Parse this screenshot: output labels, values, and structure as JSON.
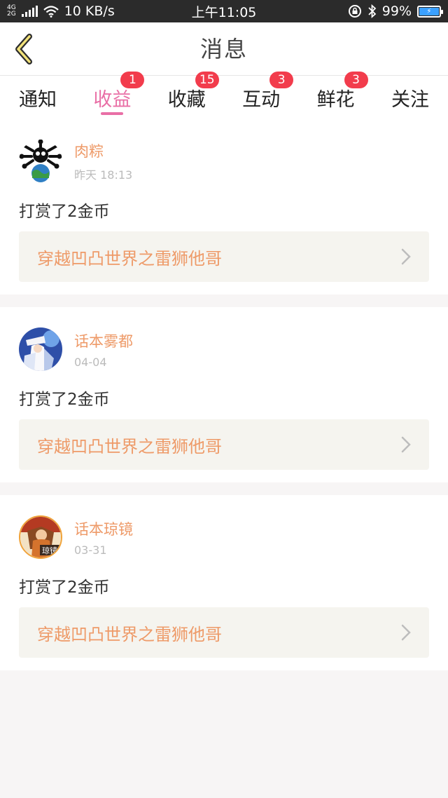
{
  "status_bar": {
    "net_top": "4G",
    "net_bottom": "2G",
    "speed": "10 KB/s",
    "time": "上午11:05",
    "battery": "99%"
  },
  "header": {
    "title": "消息",
    "back_icon": "chevron-left-icon"
  },
  "tabs": [
    {
      "label": "通知",
      "badge": ""
    },
    {
      "label": "收益",
      "badge": "1"
    },
    {
      "label": "收藏",
      "badge": "15"
    },
    {
      "label": "互动",
      "badge": "3"
    },
    {
      "label": "鲜花",
      "badge": "3"
    },
    {
      "label": "关注",
      "badge": ""
    }
  ],
  "colors": {
    "accent": "#e96fa6",
    "badge": "#f23c4c",
    "name": "#ee9a68"
  },
  "messages": [
    {
      "name": "肉粽",
      "time": "昨天 18:13",
      "action": "打赏了2金币",
      "book": "穿越凹凸世界之雷狮他哥"
    },
    {
      "name": "话本雾都",
      "time": "04-04",
      "action": "打赏了2金币",
      "book": "穿越凹凸世界之雷狮他哥"
    },
    {
      "name": "话本琼镜",
      "time": "03-31",
      "action": "打赏了2金币",
      "book": "穿越凹凸世界之雷狮他哥",
      "avatar_text": "琼镜"
    }
  ]
}
